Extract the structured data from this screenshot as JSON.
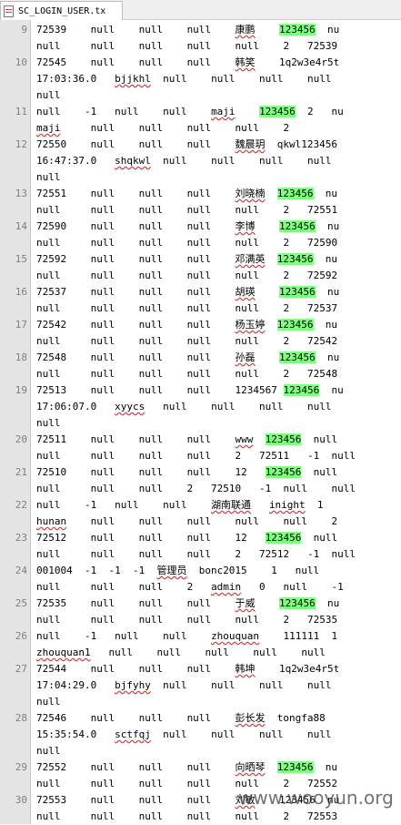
{
  "tab": {
    "label": "SC_LOGIN_USER.tx"
  },
  "lines": [
    {
      "n": "9",
      "segs": [
        [
          "72539    null    null    null    ",
          ""
        ],
        [
          "康鹏",
          "sq"
        ],
        [
          "    ",
          ""
        ],
        [
          "123456",
          "hl"
        ],
        [
          "  nu",
          ""
        ]
      ]
    },
    {
      "n": "",
      "segs": [
        [
          "null     null    null    null    null    2   72539",
          ""
        ]
      ]
    },
    {
      "n": "10",
      "segs": [
        [
          "72545    null    null    null    ",
          ""
        ],
        [
          "韩笑",
          "sq"
        ],
        [
          "    1q2w3e4r5t",
          ""
        ]
      ]
    },
    {
      "n": "",
      "segs": [
        [
          "17:03:36.0   ",
          ""
        ],
        [
          "bjjkhl",
          "sq"
        ],
        [
          "  null    null    null    null",
          ""
        ]
      ]
    },
    {
      "n": "",
      "segs": [
        [
          "null",
          ""
        ]
      ]
    },
    {
      "n": "11",
      "segs": [
        [
          "null    -1   null    null    ",
          ""
        ],
        [
          "maji",
          "sq"
        ],
        [
          "    ",
          ""
        ],
        [
          "123456",
          "hl"
        ],
        [
          "  2   nu",
          ""
        ]
      ]
    },
    {
      "n": "",
      "segs": [
        [
          "maji",
          "sq"
        ],
        [
          "     null    null    null    null    2",
          ""
        ]
      ]
    },
    {
      "n": "12",
      "segs": [
        [
          "72550    null    null    null    ",
          ""
        ],
        [
          "魏晨玥",
          "sq"
        ],
        [
          "  qkwl123456",
          ""
        ]
      ]
    },
    {
      "n": "",
      "segs": [
        [
          "16:47:37.0   ",
          ""
        ],
        [
          "shqkwl",
          "sq"
        ],
        [
          "  null    null    null    null",
          ""
        ]
      ]
    },
    {
      "n": "",
      "segs": [
        [
          "null",
          ""
        ]
      ]
    },
    {
      "n": "13",
      "segs": [
        [
          "72551    null    null    null    ",
          ""
        ],
        [
          "刘晓楠",
          "sq"
        ],
        [
          "  ",
          ""
        ],
        [
          "123456",
          "hl"
        ],
        [
          "  nu",
          ""
        ]
      ]
    },
    {
      "n": "",
      "segs": [
        [
          "null     null    null    null    null    2   72551",
          ""
        ]
      ]
    },
    {
      "n": "14",
      "segs": [
        [
          "72590    null    null    null    ",
          ""
        ],
        [
          "李博",
          "sq"
        ],
        [
          "    ",
          ""
        ],
        [
          "123456",
          "hl"
        ],
        [
          "  nu",
          ""
        ]
      ]
    },
    {
      "n": "",
      "segs": [
        [
          "null     null    null    null    null    2   72590",
          ""
        ]
      ]
    },
    {
      "n": "15",
      "segs": [
        [
          "72592    null    null    null    ",
          ""
        ],
        [
          "邓满英",
          "sq"
        ],
        [
          "  ",
          ""
        ],
        [
          "123456",
          "hl"
        ],
        [
          "  nu",
          ""
        ]
      ]
    },
    {
      "n": "",
      "segs": [
        [
          "null     null    null    null    null    2   72592",
          ""
        ]
      ]
    },
    {
      "n": "16",
      "segs": [
        [
          "72537    null    null    null    ",
          ""
        ],
        [
          "胡瑛",
          "sq"
        ],
        [
          "    ",
          ""
        ],
        [
          "123456",
          "hl"
        ],
        [
          "  nu",
          ""
        ]
      ]
    },
    {
      "n": "",
      "segs": [
        [
          "null     null    null    null    null    2   72537",
          ""
        ]
      ]
    },
    {
      "n": "17",
      "segs": [
        [
          "72542    null    null    null    ",
          ""
        ],
        [
          "杨玉婷",
          "sq"
        ],
        [
          "  ",
          ""
        ],
        [
          "123456",
          "hl"
        ],
        [
          "  nu",
          ""
        ]
      ]
    },
    {
      "n": "",
      "segs": [
        [
          "null     null    null    null    null    2   72542",
          ""
        ]
      ]
    },
    {
      "n": "18",
      "segs": [
        [
          "72548    null    null    null    ",
          ""
        ],
        [
          "孙磊",
          "sq"
        ],
        [
          "    ",
          ""
        ],
        [
          "123456",
          "hl"
        ],
        [
          "  nu",
          ""
        ]
      ]
    },
    {
      "n": "",
      "segs": [
        [
          "null     null    null    null    null    2   72548",
          ""
        ]
      ]
    },
    {
      "n": "19",
      "segs": [
        [
          "72513    null    null    null    1234567 ",
          ""
        ],
        [
          "123456",
          "hl"
        ],
        [
          "  nu",
          ""
        ]
      ]
    },
    {
      "n": "",
      "segs": [
        [
          "17:06:07.0   ",
          ""
        ],
        [
          "xyycs",
          "sq"
        ],
        [
          "   null    null    null    null",
          ""
        ]
      ]
    },
    {
      "n": "",
      "segs": [
        [
          "null",
          ""
        ]
      ]
    },
    {
      "n": "20",
      "segs": [
        [
          "72511    null    null    null    ",
          ""
        ],
        [
          "www",
          "sq"
        ],
        [
          "  ",
          ""
        ],
        [
          "123456",
          "hl"
        ],
        [
          "  null",
          ""
        ]
      ]
    },
    {
      "n": "",
      "segs": [
        [
          "null     null    null    null    2   72511   -1  null",
          ""
        ]
      ]
    },
    {
      "n": "21",
      "segs": [
        [
          "72510    null    null    null    12   ",
          ""
        ],
        [
          "123456",
          "hl"
        ],
        [
          "  null",
          ""
        ]
      ]
    },
    {
      "n": "",
      "segs": [
        [
          "null     null    null    2   72510   -1  null    null",
          ""
        ]
      ]
    },
    {
      "n": "22",
      "segs": [
        [
          "null    -1   null    null    ",
          ""
        ],
        [
          "湖南联通",
          "sq"
        ],
        [
          "   ",
          ""
        ],
        [
          "inight",
          "sq"
        ],
        [
          "  1",
          ""
        ]
      ]
    },
    {
      "n": "",
      "segs": [
        [
          "hunan",
          "sq"
        ],
        [
          "    null    null    null    null    null    2",
          ""
        ]
      ]
    },
    {
      "n": "23",
      "segs": [
        [
          "72512    null    null    null    12   ",
          ""
        ],
        [
          "123456",
          "hl"
        ],
        [
          "  null",
          ""
        ]
      ]
    },
    {
      "n": "",
      "segs": [
        [
          "null     null    null    null    2   72512   -1  null",
          ""
        ]
      ]
    },
    {
      "n": "24",
      "segs": [
        [
          "001004  -1  -1  -1  ",
          ""
        ],
        [
          "管理员",
          "sq"
        ],
        [
          "  bonc2015    1   null",
          ""
        ]
      ]
    },
    {
      "n": "",
      "segs": [
        [
          "null     null    null    2   ",
          ""
        ],
        [
          "admin",
          "sq"
        ],
        [
          "   0   null    -1",
          ""
        ]
      ]
    },
    {
      "n": "25",
      "segs": [
        [
          "72535    null    null    null    ",
          ""
        ],
        [
          "于威",
          "sq"
        ],
        [
          "    ",
          ""
        ],
        [
          "123456",
          "hl"
        ],
        [
          "  nu",
          ""
        ]
      ]
    },
    {
      "n": "",
      "segs": [
        [
          "null     null    null    null    null    2   72535",
          ""
        ]
      ]
    },
    {
      "n": "26",
      "segs": [
        [
          "null    -1   null    null    ",
          ""
        ],
        [
          "zhouquan",
          "sq"
        ],
        [
          "    111111  1",
          ""
        ]
      ]
    },
    {
      "n": "",
      "segs": [
        [
          "zhouquan1",
          "sq"
        ],
        [
          "   null    null    null    null    null",
          ""
        ]
      ]
    },
    {
      "n": "27",
      "segs": [
        [
          "72544    null    null    null    ",
          ""
        ],
        [
          "韩坤",
          "sq"
        ],
        [
          "    1q2w3e4r5t",
          ""
        ]
      ]
    },
    {
      "n": "",
      "segs": [
        [
          "17:04:29.0   ",
          ""
        ],
        [
          "bjfyhy",
          "sq"
        ],
        [
          "  null    null    null    null",
          ""
        ]
      ]
    },
    {
      "n": "",
      "segs": [
        [
          "null",
          ""
        ]
      ]
    },
    {
      "n": "28",
      "segs": [
        [
          "72546    null    null    null    ",
          ""
        ],
        [
          "彭长发",
          "sq"
        ],
        [
          "  tongfa88",
          ""
        ]
      ]
    },
    {
      "n": "",
      "segs": [
        [
          "15:35:54.0   ",
          ""
        ],
        [
          "sctfqj",
          "sq"
        ],
        [
          "  null    null    null    null",
          ""
        ]
      ]
    },
    {
      "n": "",
      "segs": [
        [
          "null",
          ""
        ]
      ]
    },
    {
      "n": "29",
      "segs": [
        [
          "72552    null    null    null    ",
          ""
        ],
        [
          "向晒琴",
          "sq"
        ],
        [
          "  ",
          ""
        ],
        [
          "123456",
          "hl"
        ],
        [
          "  nu",
          ""
        ]
      ]
    },
    {
      "n": "",
      "segs": [
        [
          "null     null    null    null    null    2   72552",
          ""
        ]
      ]
    },
    {
      "n": "30",
      "segs": [
        [
          "72553    null    null    null    ",
          ""
        ],
        [
          "刘敏",
          "sq"
        ],
        [
          "    123456  nu",
          ""
        ]
      ]
    },
    {
      "n": "",
      "segs": [
        [
          "null     null    null    null    null    2   72553",
          ""
        ]
      ]
    }
  ],
  "watermark": "www.wooyun.org"
}
